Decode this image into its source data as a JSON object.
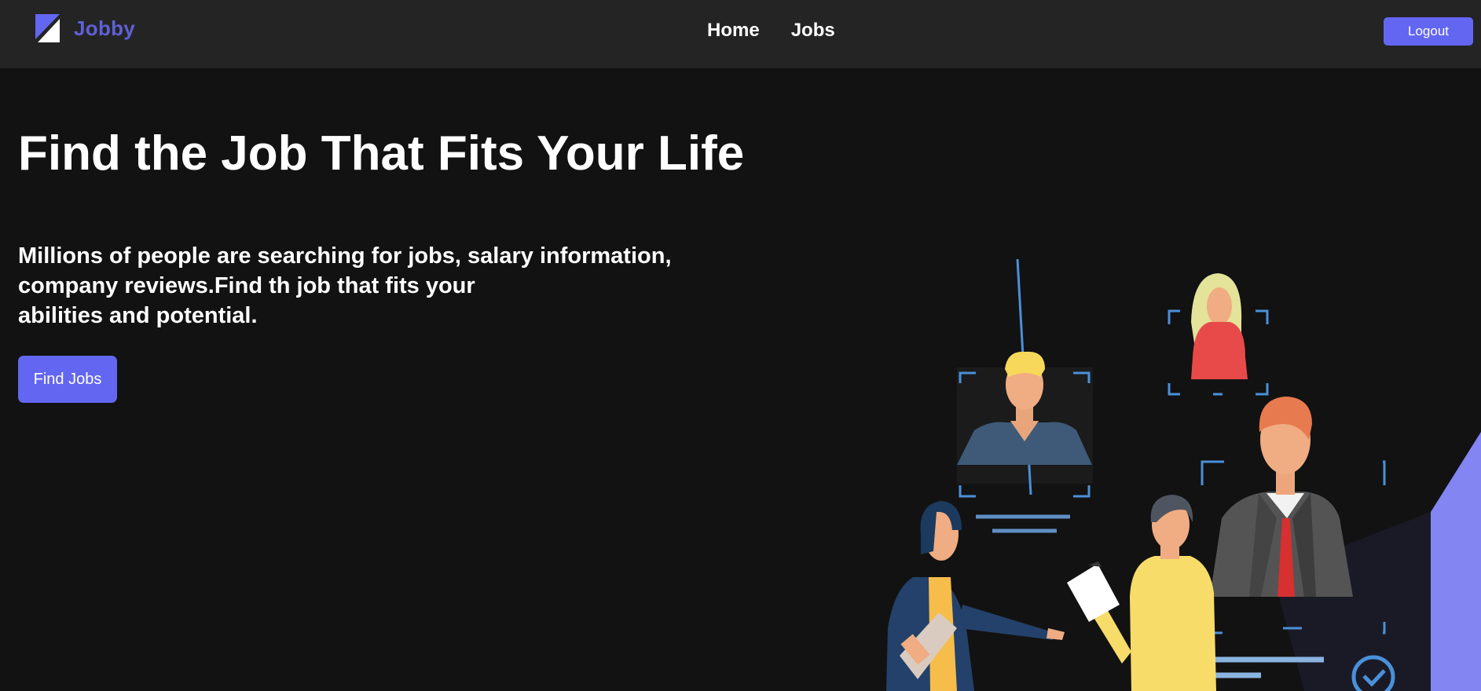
{
  "header": {
    "logo_text": "Jobby",
    "logo_icon": "jobby-logo-icon",
    "nav": [
      {
        "label": "Home"
      },
      {
        "label": "Jobs"
      }
    ],
    "logout_label": "Logout"
  },
  "hero": {
    "title": "Find the Job That Fits Your Life",
    "description_lines": [
      "Millions of people are searching for jobs, salary information,",
      "company reviews.Find th job that fits your",
      "abilities and potential."
    ],
    "cta_label": "Find Jobs"
  },
  "colors": {
    "accent": "#6366f1",
    "logo_text": "#5f60d6",
    "navbar_bg": "#242424",
    "page_bg": "#121212"
  }
}
